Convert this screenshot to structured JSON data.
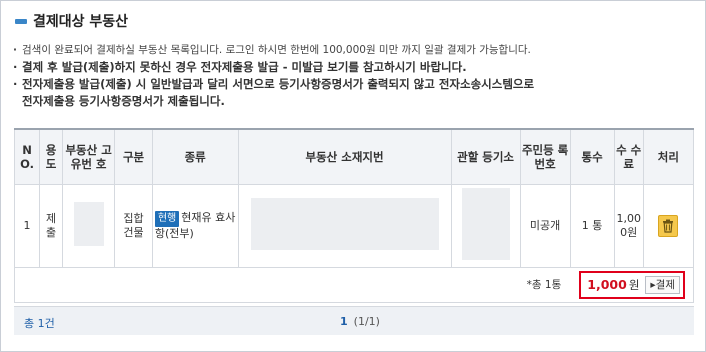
{
  "title": "결제대상 부동산",
  "notes": {
    "n1": "검색이 완료되어 결제하실 부동산 목록입니다. 로그인 하시면 한번에 100,000원 미만 까지 일괄 결제가 가능합니다.",
    "n2": "결제 후 발급(제출)하지 못하신 경우 전자제출용 발급 - 미발급 보기를 참고하시기 바랍니다.",
    "n3a": "전자제출용 발급(제출) 시 일반발급과 달리 서면으로 등기사항증명서가 출력되지 않고 전자소송시스템으로",
    "n3b": "전자제출용 등기사항증명서가 제출됩니다."
  },
  "table": {
    "headers": {
      "no": "N O.",
      "usage": "용 도",
      "id": "부동산 고유번 호",
      "type": "구분",
      "kind": "종류",
      "address": "부동산 소재지번",
      "office": "관할 등기소",
      "resident": "주민등 록번호",
      "copies": "통수",
      "fee": "수 수 료",
      "action": "처리"
    },
    "row": {
      "no": "1",
      "usage": "제 출",
      "type": "집합 건물",
      "badge": "현행",
      "kind": "현재유 효사항(전부)",
      "resident": "미공개",
      "copies": "1 통",
      "fee": "1,00 0원"
    },
    "total": {
      "count": "*총 1통",
      "amount": "1,000",
      "won": "원",
      "pay_button": "▸결제"
    }
  },
  "footer": {
    "count": "총 1건",
    "page_current": "1",
    "page_total": "(1/1)"
  },
  "colors": {
    "accent": "#1f6fb8",
    "highlight_border": "#e0001b",
    "amount": "#d10f1f",
    "trash": "#f5c84c"
  }
}
